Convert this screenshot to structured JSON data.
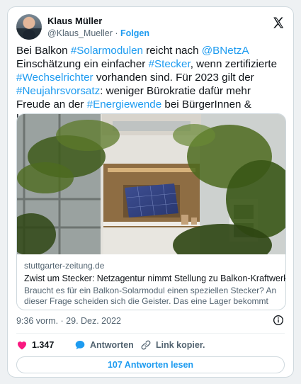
{
  "author": {
    "name": "Klaus Müller",
    "handle": "@Klaus_Mueller",
    "separator": "·",
    "follow_label": "Folgen"
  },
  "tweet": {
    "segments": [
      {
        "text": "Bei Balkon ",
        "tag": false
      },
      {
        "text": "#Solarmodulen",
        "tag": true
      },
      {
        "text": " reicht nach ",
        "tag": false
      },
      {
        "text": "@BNetzA",
        "tag": true
      },
      {
        "text": " Einschätzung ein einfacher ",
        "tag": false
      },
      {
        "text": "#Stecker",
        "tag": true
      },
      {
        "text": ", wenn zertifizierte ",
        "tag": false
      },
      {
        "text": "#Wechselrichter",
        "tag": true
      },
      {
        "text": " vorhanden sind. Für 2023 gilt der ",
        "tag": false
      },
      {
        "text": "#Neujahrsvorsatz",
        "tag": true
      },
      {
        "text": ": weniger Bürokratie dafür mehr Freude an der ",
        "tag": false
      },
      {
        "text": "#Energiewende",
        "tag": true
      },
      {
        "text": " bei BürgerInnen & Unternehmen",
        "tag": false
      }
    ]
  },
  "link_card": {
    "domain": "stuttgarter-zeitung.de",
    "title": "Zwist um Stecker: Netzagentur nimmt Stellung zu Balkon-Kraftwerken",
    "description": "Braucht es für ein Balkon-Solarmodul einen speziellen Stecker? An dieser Frage scheiden sich die Geister. Das eine Lager bekommt nun ..."
  },
  "timestamp": "9:36 vorm. · 29. Dez. 2022",
  "actions": {
    "likes": "1.347",
    "reply_label": "Antworten",
    "copy_link_label": "Link kopier."
  },
  "read_replies_label": "107 Antworten lesen",
  "colors": {
    "accent": "#1d9bf0",
    "like": "#f91880",
    "text": "#0f1419",
    "muted": "#536471"
  },
  "icons": [
    "x-logo-icon",
    "info-icon",
    "heart-icon",
    "reply-bubble-icon",
    "link-icon"
  ]
}
